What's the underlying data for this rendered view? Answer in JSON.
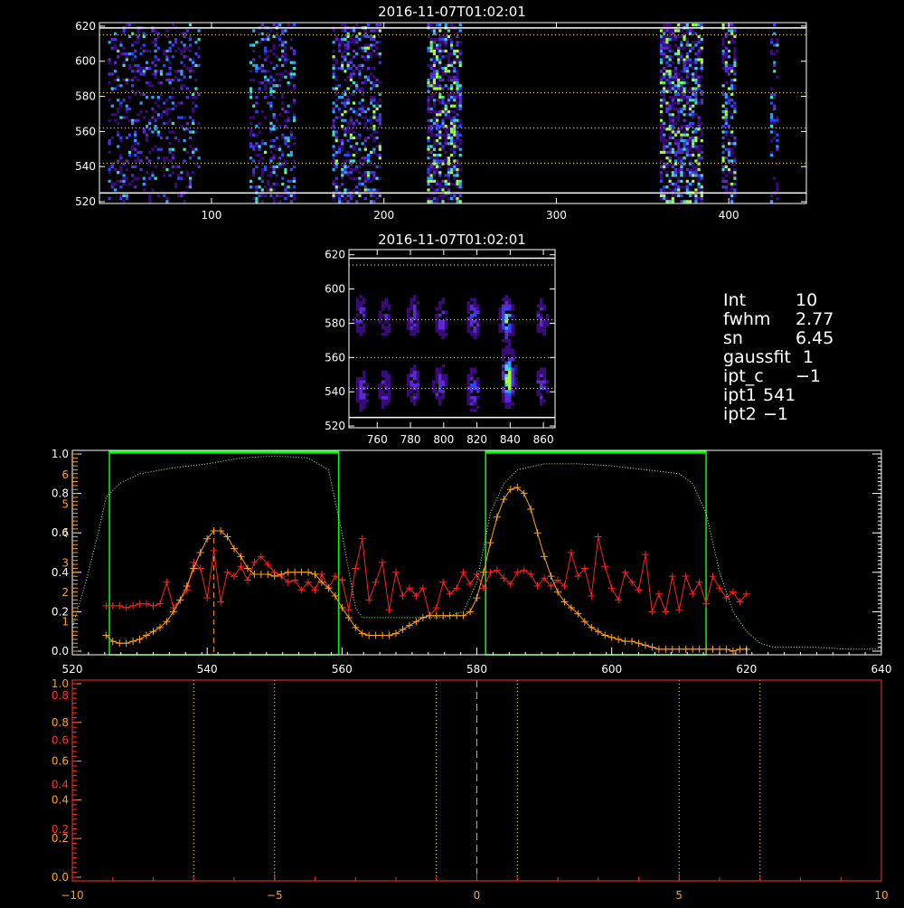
{
  "panels": {
    "top_title": "2016-11-07T01:02:01",
    "mid_title": "2016-11-07T01:02:01"
  },
  "info": [
    {
      "key": "Int",
      "value": "10"
    },
    {
      "key": "fwhm",
      "value": "2.77"
    },
    {
      "key": "sn",
      "value": "6.45"
    },
    {
      "key": "gaussfit",
      "value": "1"
    },
    {
      "key": "ipt_c",
      "value": "−1"
    },
    {
      "key": "ipt1",
      "value": "541"
    },
    {
      "key": "ipt2",
      "value": "−1"
    }
  ],
  "colors": {
    "background": "#000000",
    "axes": "#ffffff",
    "red_series": "#ff2020",
    "orange_series": "#ffa020",
    "green": "#00ff00",
    "green_dotted": "#b0ffb0",
    "dotted_guides": "#ffff80",
    "axis_red": "#ff3030",
    "axis_orange": "#ffa020"
  },
  "chart_data": [
    {
      "type": "heatmap",
      "title": "2016-11-07T01:02:01",
      "xlim": [
        35,
        445
      ],
      "ylim": [
        519,
        622
      ],
      "xticks": [
        100,
        200,
        300,
        400
      ],
      "yticks": [
        520,
        540,
        560,
        580,
        600,
        620
      ],
      "white_lines_y": [
        525,
        619
      ],
      "dotted_lines_y": [
        542,
        562,
        582,
        615
      ],
      "bands": [
        {
          "x0": 40,
          "x1": 55,
          "density": 0.28
        },
        {
          "x0": 55,
          "x1": 93,
          "density": 0.22
        },
        {
          "x0": 122,
          "x1": 148,
          "density": 0.3
        },
        {
          "x0": 170,
          "x1": 197,
          "density": 0.42
        },
        {
          "x0": 225,
          "x1": 244,
          "density": 0.6
        },
        {
          "x0": 360,
          "x1": 384,
          "density": 0.6
        },
        {
          "x0": 396,
          "x1": 404,
          "density": 0.5
        },
        {
          "x0": 424,
          "x1": 429,
          "density": 0.25
        }
      ]
    },
    {
      "type": "heatmap",
      "title": "2016-11-07T01:02:01",
      "xlim": [
        743,
        867
      ],
      "ylim": [
        519,
        623
      ],
      "xticks": [
        760,
        780,
        800,
        820,
        840,
        860
      ],
      "yticks": [
        520,
        540,
        560,
        580,
        600,
        620
      ],
      "white_lines_y": [
        525,
        618
      ],
      "dotted_lines_y": [
        542,
        560,
        582,
        614
      ],
      "blobs": [
        {
          "x": 750,
          "y": 542,
          "amp": 0.5
        },
        {
          "x": 749,
          "y": 585,
          "amp": 0.45
        },
        {
          "x": 764,
          "y": 542,
          "amp": 0.4
        },
        {
          "x": 764,
          "y": 584,
          "amp": 0.35
        },
        {
          "x": 781,
          "y": 585,
          "amp": 0.5
        },
        {
          "x": 781,
          "y": 545,
          "amp": 0.45
        },
        {
          "x": 797,
          "y": 545,
          "amp": 0.55
        },
        {
          "x": 798,
          "y": 583,
          "amp": 0.5
        },
        {
          "x": 817,
          "y": 542,
          "amp": 0.65
        },
        {
          "x": 817,
          "y": 584,
          "amp": 0.6
        },
        {
          "x": 837,
          "y": 583,
          "amp": 1.0
        },
        {
          "x": 838,
          "y": 545,
          "amp": 0.95
        },
        {
          "x": 838,
          "y": 555,
          "amp": 0.7
        },
        {
          "x": 858,
          "y": 544,
          "amp": 0.45
        },
        {
          "x": 858,
          "y": 584,
          "amp": 0.4
        }
      ]
    },
    {
      "type": "line",
      "xlim": [
        520,
        640
      ],
      "ylim": [
        0,
        1.0
      ],
      "xticks": [
        520,
        540,
        560,
        580,
        600,
        620,
        640
      ],
      "yticks_left": [
        "0.0",
        "0.2",
        "0.4",
        "0.6",
        "0.8",
        "1.0"
      ],
      "yticks_left_orange": [
        "1",
        "2",
        "3",
        "4",
        "5",
        "6"
      ],
      "green_windows": [
        [
          525.5,
          559.5
        ],
        [
          581.3,
          614
        ]
      ],
      "dashed_marker_x": 541,
      "series": [
        {
          "color": "red",
          "x": [
            525,
            526,
            527,
            528,
            529,
            530,
            531,
            532,
            533,
            534,
            535,
            536,
            537,
            538,
            539,
            540,
            541,
            542,
            543,
            544,
            545,
            546,
            547,
            548,
            549,
            550,
            551,
            552,
            553,
            554,
            555,
            556,
            557,
            558,
            559,
            560,
            561,
            562,
            563,
            564,
            565,
            566,
            567,
            568,
            569,
            570,
            571,
            572,
            573,
            574,
            575,
            576,
            577,
            578,
            579,
            580,
            581,
            582,
            583,
            584,
            585,
            586,
            587,
            588,
            589,
            590,
            591,
            592,
            593,
            594,
            595,
            596,
            597,
            598,
            599,
            600,
            601,
            602,
            603,
            604,
            605,
            606,
            607,
            608,
            609,
            610,
            611,
            612,
            613,
            614,
            615,
            616,
            617,
            618,
            619,
            620
          ],
          "y": [
            0.23,
            0.23,
            0.23,
            0.22,
            0.23,
            0.24,
            0.24,
            0.23,
            0.24,
            0.35,
            0.22,
            0.26,
            0.31,
            0.45,
            0.42,
            0.27,
            0.51,
            0.25,
            0.4,
            0.38,
            0.43,
            0.36,
            0.45,
            0.48,
            0.44,
            0.4,
            0.38,
            0.35,
            0.36,
            0.31,
            0.35,
            0.31,
            0.39,
            0.32,
            0.38,
            0.36,
            0.21,
            0.42,
            0.57,
            0.26,
            0.35,
            0.45,
            0.21,
            0.4,
            0.28,
            0.32,
            0.28,
            0.32,
            0.18,
            0.22,
            0.35,
            0.29,
            0.32,
            0.4,
            0.34,
            0.39,
            0.32,
            0.4,
            0.41,
            0.37,
            0.34,
            0.4,
            0.41,
            0.39,
            0.33,
            0.37,
            0.33,
            0.36,
            0.33,
            0.5,
            0.38,
            0.42,
            0.28,
            0.58,
            0.43,
            0.32,
            0.26,
            0.4,
            0.35,
            0.31,
            0.49,
            0.2,
            0.29,
            0.2,
            0.38,
            0.21,
            0.38,
            0.29,
            0.35,
            0.24,
            0.38,
            0.32,
            0.27,
            0.3,
            0.25,
            0.29
          ]
        },
        {
          "color": "orange",
          "x": [
            525,
            526,
            527,
            528,
            529,
            530,
            531,
            532,
            533,
            534,
            535,
            536,
            537,
            538,
            539,
            540,
            541,
            542,
            543,
            544,
            545,
            546,
            547,
            548,
            549,
            550,
            551,
            552,
            553,
            554,
            555,
            556,
            557,
            558,
            559,
            560,
            561,
            562,
            563,
            564,
            565,
            566,
            567,
            568,
            569,
            570,
            571,
            572,
            573,
            574,
            575,
            576,
            577,
            578,
            579,
            580,
            581,
            582,
            583,
            584,
            585,
            586,
            587,
            588,
            589,
            590,
            591,
            592,
            593,
            594,
            595,
            596,
            597,
            598,
            599,
            600,
            601,
            602,
            603,
            604,
            605,
            606,
            607,
            608,
            609,
            610,
            611,
            612,
            613,
            614,
            615,
            616,
            617,
            618,
            619,
            620
          ],
          "y": [
            0.08,
            0.05,
            0.04,
            0.04,
            0.05,
            0.06,
            0.08,
            0.1,
            0.12,
            0.15,
            0.2,
            0.26,
            0.33,
            0.42,
            0.5,
            0.57,
            0.61,
            0.61,
            0.58,
            0.52,
            0.48,
            0.42,
            0.39,
            0.39,
            0.39,
            0.38,
            0.39,
            0.4,
            0.4,
            0.4,
            0.4,
            0.39,
            0.35,
            0.32,
            0.28,
            0.22,
            0.17,
            0.12,
            0.09,
            0.08,
            0.08,
            0.08,
            0.08,
            0.09,
            0.11,
            0.13,
            0.15,
            0.17,
            0.18,
            0.18,
            0.18,
            0.18,
            0.18,
            0.18,
            0.2,
            0.27,
            0.4,
            0.55,
            0.68,
            0.77,
            0.82,
            0.83,
            0.8,
            0.72,
            0.6,
            0.48,
            0.38,
            0.3,
            0.25,
            0.22,
            0.19,
            0.15,
            0.12,
            0.1,
            0.08,
            0.07,
            0.06,
            0.05,
            0.05,
            0.04,
            0.03,
            0.02,
            0.01,
            0.01,
            0.01,
            0.01,
            0.01,
            0.01,
            0.01,
            0.01,
            0.01,
            0.01,
            0.01,
            0.0,
            0.01,
            0.01
          ]
        },
        {
          "color": "green-dotted",
          "x": [
            520,
            522,
            524,
            525,
            527,
            530,
            535,
            540,
            545,
            550,
            555,
            558,
            560,
            562,
            563,
            565,
            570,
            575,
            578,
            580,
            582,
            584,
            586,
            590,
            595,
            600,
            605,
            610,
            612,
            614,
            616,
            618,
            620,
            622,
            624,
            630,
            635,
            640
          ],
          "y": [
            0.12,
            0.35,
            0.62,
            0.78,
            0.85,
            0.9,
            0.93,
            0.95,
            0.98,
            0.99,
            0.98,
            0.92,
            0.6,
            0.22,
            0.17,
            0.17,
            0.17,
            0.17,
            0.2,
            0.35,
            0.7,
            0.85,
            0.92,
            0.95,
            0.95,
            0.94,
            0.92,
            0.9,
            0.85,
            0.7,
            0.4,
            0.2,
            0.1,
            0.04,
            0.02,
            0.02,
            0.01,
            0.01
          ]
        }
      ]
    },
    {
      "type": "line",
      "xlim": [
        -10,
        10
      ],
      "xticks": [
        -10,
        -5,
        0,
        5,
        10
      ],
      "ylim": [
        0,
        1.0
      ],
      "yticks_left": [
        "0.0",
        "0.2",
        "0.4",
        "0.6",
        "0.8",
        "1.0"
      ],
      "yticks_left_red": [
        "0.2",
        "0.4",
        "0.6",
        "0.8"
      ],
      "dotted_x": [
        -7,
        -5,
        -1,
        1,
        5,
        7
      ],
      "dashed_x": 0
    }
  ]
}
